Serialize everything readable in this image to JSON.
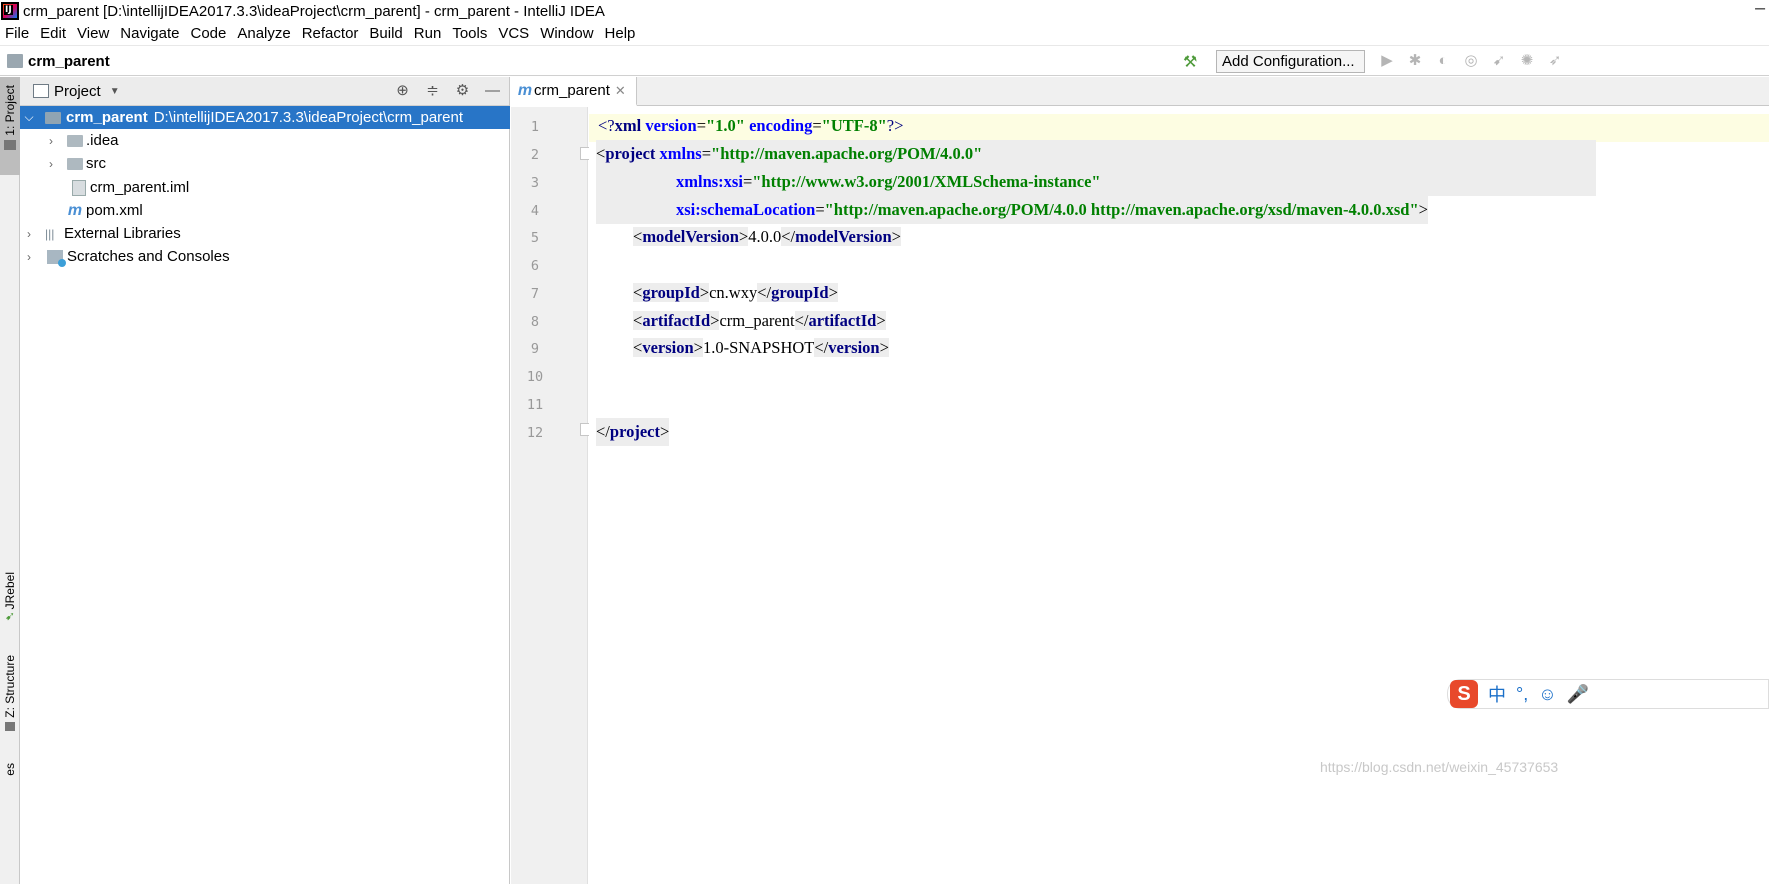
{
  "window": {
    "title": "crm_parent [D:\\intellijIDEA2017.3.3\\ideaProject\\crm_parent] - crm_parent - IntelliJ IDEA"
  },
  "menu": [
    "File",
    "Edit",
    "View",
    "Navigate",
    "Code",
    "Analyze",
    "Refactor",
    "Build",
    "Run",
    "Tools",
    "VCS",
    "Window",
    "Help"
  ],
  "navbar": {
    "project": "crm_parent",
    "run_config": "Add Configuration..."
  },
  "sidebar_tabs": {
    "project": "1: Project",
    "jrebel": "JRebel",
    "structure": "Z: Structure",
    "favorites": "es"
  },
  "project_panel": {
    "title": "Project",
    "tree": [
      {
        "label": "crm_parent",
        "path": "D:\\intellijIDEA2017.3.3\\ideaProject\\crm_parent"
      },
      {
        "label": ".idea"
      },
      {
        "label": "src"
      },
      {
        "label": "crm_parent.iml"
      },
      {
        "label": "pom.xml"
      },
      {
        "label": "External Libraries"
      },
      {
        "label": "Scratches and Consoles"
      }
    ]
  },
  "editor": {
    "tab_label": "crm_parent",
    "line_numbers": [
      "1",
      "2",
      "3",
      "4",
      "5",
      "6",
      "7",
      "8",
      "9",
      "10",
      "11",
      "12"
    ],
    "l1": {
      "a": "<?",
      "b": "xml",
      "c": " version",
      "d": "=",
      "e": "\"1.0\"",
      "f": " encoding",
      "g": "=",
      "h": "\"UTF-8\"",
      "i": "?>"
    },
    "l2": {
      "a": "<",
      "b": "project",
      "c": " xmlns",
      "d": "=",
      "e": "\"http://maven.apache.org/POM/4.0.0\""
    },
    "l3": {
      "c": "xmlns:xsi",
      "d": "=",
      "e": "\"http://www.w3.org/2001/XMLSchema-instance\""
    },
    "l4": {
      "c": "xsi:schemaLocation",
      "d": "=",
      "e": "\"http://maven.apache.org/POM/4.0.0 http://maven.apache.org/xsd/maven-4.0.0.xsd\"",
      "f": ">"
    },
    "l5": {
      "o": "<",
      "t": "modelVersion",
      "c": ">",
      "v": "4.0.0",
      "o2": "</",
      "t2": "modelVersion",
      "c2": ">"
    },
    "l7": {
      "o": "<",
      "t": "groupId",
      "c": ">",
      "v": "cn.wxy",
      "o2": "</",
      "t2": "groupId",
      "c2": ">"
    },
    "l8": {
      "o": "<",
      "t": "artifactId",
      "c": ">",
      "v": "crm_parent",
      "o2": "</",
      "t2": "artifactId",
      "c2": ">"
    },
    "l9": {
      "o": "<",
      "t": "version",
      "c": ">",
      "v": "1.0-SNAPSHOT",
      "o2": "</",
      "t2": "version",
      "c2": ">"
    },
    "l12": {
      "o": "</",
      "t": "project",
      "c": ">"
    }
  },
  "ime": {
    "logo": "S",
    "items": [
      "中",
      "°,",
      "☺",
      "🎤"
    ]
  },
  "watermark": "https://blog.csdn.net/weixin_45737653",
  "colors": {
    "selection": "#2875c7",
    "tag": "#000080",
    "attr": "#0000ff",
    "value": "#008000",
    "current_line": "#fdfde2"
  }
}
